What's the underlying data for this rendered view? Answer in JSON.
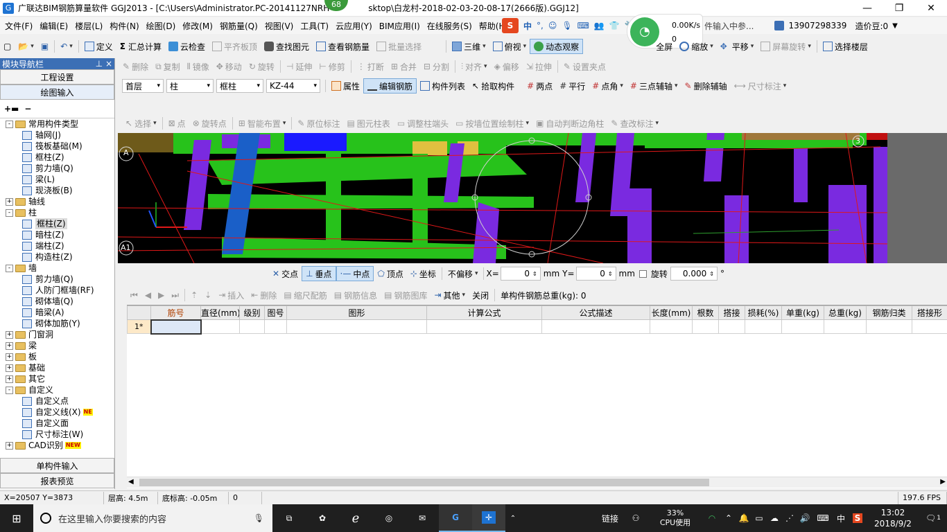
{
  "window": {
    "title": "广联达BIM钢筋算量软件 GGJ2013 - [C:\\Users\\Administrator.PC-20141127NRH",
    "title_tail": "sktop\\白龙村-2018-02-03-20-08-17(2666版).GGJ12]",
    "badge": "68"
  },
  "menu": [
    "文件(F)",
    "编辑(E)",
    "楼层(L)",
    "构件(N)",
    "绘图(D)",
    "修改(M)",
    "钢筋量(Q)",
    "视图(V)",
    "工具(T)",
    "云应用(Y)",
    "BIM应用(I)",
    "在线服务(S)",
    "帮助(H)"
  ],
  "menu_right": {
    "ime_text": "中",
    "net_speed": "0.00K/s",
    "net_count": "0",
    "phone": "13907298339",
    "cost_label": "造价豆:0",
    "hint": "件输入中参..."
  },
  "toolbar1": [
    "定义",
    "汇总计算",
    "云检查",
    "平齐板顶",
    "查找图元",
    "查看钢筋量",
    "批量选择",
    "三维",
    "俯视",
    "动态观察",
    "全屏",
    "缩放",
    "平移",
    "屏幕旋转",
    "选择楼层"
  ],
  "toolbar2": [
    "删除",
    "复制",
    "镜像",
    "移动",
    "旋转",
    "延伸",
    "修剪",
    "打断",
    "合并",
    "分割",
    "对齐",
    "偏移",
    "拉伸",
    "设置夹点"
  ],
  "toolbar3": {
    "floor": "首层",
    "category": "柱",
    "type": "框柱",
    "name": "KZ-44",
    "buttons": [
      "属性",
      "编辑钢筋",
      "构件列表",
      "拾取构件"
    ],
    "draw": [
      "两点",
      "平行",
      "点角",
      "三点辅轴",
      "删除辅轴",
      "尺寸标注"
    ]
  },
  "toolbar4": [
    "选择",
    "点",
    "旋转点",
    "智能布置",
    "原位标注",
    "图元柱表",
    "调整柱端头",
    "按墙位置绘制柱",
    "自动判断边角柱",
    "查改标注"
  ],
  "nav": {
    "header": "模块导航栏",
    "top_buttons": [
      "工程设置",
      "绘图输入"
    ],
    "bottom_buttons": [
      "单构件输入",
      "报表预览"
    ],
    "tree": [
      {
        "level": 0,
        "exp": "-",
        "folder": true,
        "label": "常用构件类型"
      },
      {
        "level": 1,
        "label": "轴网(J)"
      },
      {
        "level": 1,
        "label": "筏板基础(M)"
      },
      {
        "level": 1,
        "label": "框柱(Z)"
      },
      {
        "level": 1,
        "label": "剪力墙(Q)"
      },
      {
        "level": 1,
        "label": "梁(L)"
      },
      {
        "level": 1,
        "label": "现浇板(B)"
      },
      {
        "level": 0,
        "exp": "+",
        "folder": true,
        "label": "轴线"
      },
      {
        "level": 0,
        "exp": "-",
        "folder": true,
        "label": "柱"
      },
      {
        "level": 1,
        "label": "框柱(Z)",
        "selected": true
      },
      {
        "level": 1,
        "label": "暗柱(Z)"
      },
      {
        "level": 1,
        "label": "端柱(Z)"
      },
      {
        "level": 1,
        "label": "构造柱(Z)"
      },
      {
        "level": 0,
        "exp": "-",
        "folder": true,
        "label": "墙"
      },
      {
        "level": 1,
        "label": "剪力墙(Q)"
      },
      {
        "level": 1,
        "label": "人防门框墙(RF)"
      },
      {
        "level": 1,
        "label": "砌体墙(Q)"
      },
      {
        "level": 1,
        "label": "暗梁(A)"
      },
      {
        "level": 1,
        "label": "砌体加筋(Y)"
      },
      {
        "level": 0,
        "exp": "+",
        "folder": true,
        "label": "门窗洞"
      },
      {
        "level": 0,
        "exp": "+",
        "folder": true,
        "label": "梁"
      },
      {
        "level": 0,
        "exp": "+",
        "folder": true,
        "label": "板"
      },
      {
        "level": 0,
        "exp": "+",
        "folder": true,
        "label": "基础"
      },
      {
        "level": 0,
        "exp": "+",
        "folder": true,
        "label": "其它"
      },
      {
        "level": 0,
        "exp": "-",
        "folder": true,
        "label": "自定义"
      },
      {
        "level": 1,
        "label": "自定义点"
      },
      {
        "level": 1,
        "label": "自定义线(X)",
        "badge": "NE"
      },
      {
        "level": 1,
        "label": "自定义面"
      },
      {
        "level": 1,
        "label": "尺寸标注(W)"
      },
      {
        "level": 0,
        "exp": "+",
        "folder": true,
        "label": "CAD识别",
        "badge": "NEW"
      }
    ]
  },
  "viewport": {
    "axis_a": "A",
    "axis_a1": "A1",
    "axis_3": "3"
  },
  "snapbar": {
    "items": [
      "交点",
      "垂点",
      "中点",
      "顶点",
      "坐标"
    ],
    "offset": "不偏移",
    "x_label": "X=",
    "x_value": "0",
    "y_label": "Y=",
    "y_value": "0",
    "unit": "mm",
    "rotate_label": "旋转",
    "rotate_value": "0.000",
    "degree": "°"
  },
  "rebar_toolbar": {
    "buttons": [
      "插入",
      "删除",
      "缩尺配筋",
      "钢筋信息",
      "钢筋图库",
      "其他",
      "关闭"
    ],
    "total": "单构件钢筋总重(kg): 0"
  },
  "grid": {
    "columns": [
      "筋号",
      "直径(mm)",
      "级别",
      "图号",
      "图形",
      "计算公式",
      "公式描述",
      "长度(mm)",
      "根数",
      "搭接",
      "损耗(%)",
      "单重(kg)",
      "总重(kg)",
      "钢筋归类",
      "搭接形"
    ],
    "row_label": "1*"
  },
  "status": {
    "coords": "X=20507 Y=3873",
    "floor_height": "层高: 4.5m",
    "base_height": "底标高: -0.05m",
    "value": "0",
    "fps": "197.6 FPS"
  },
  "taskbar": {
    "search": "在这里输入你要搜索的内容",
    "link": "链接",
    "cpu_pct": "33%",
    "cpu_label": "CPU使用",
    "ime": "中",
    "time": "13:02",
    "date": "2018/9/2",
    "notif": "1"
  }
}
